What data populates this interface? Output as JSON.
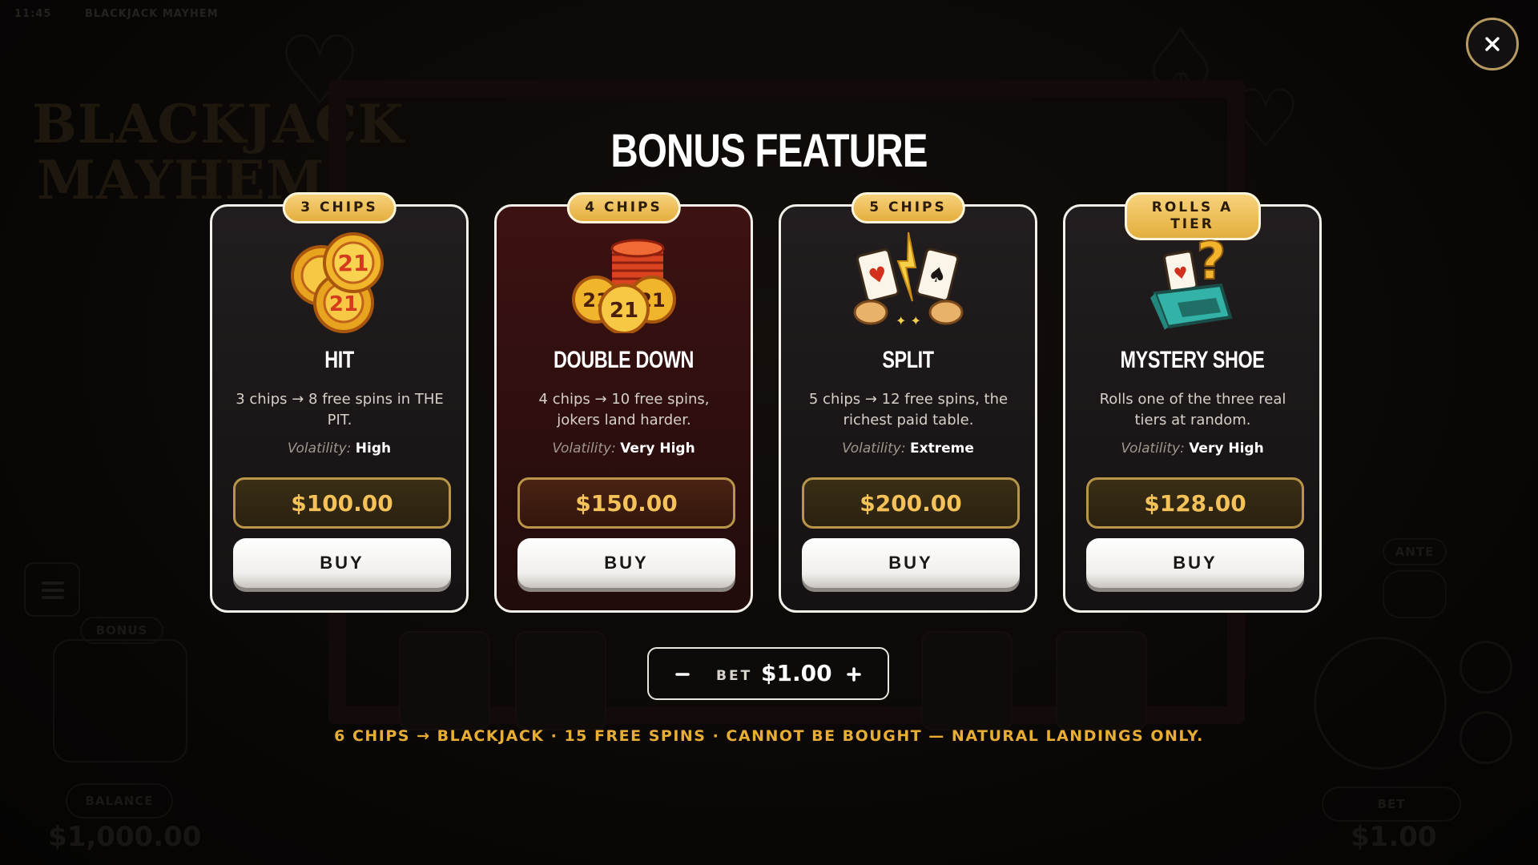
{
  "background": {
    "top_left": [
      "11:45",
      "BLACKJACK MAYHEM"
    ],
    "logo_line1": "BLACKJACK",
    "logo_line2": "MAYHEM",
    "bonus_label": "BONUS",
    "balance_label": "BALANCE",
    "balance_value": "$1,000.00",
    "ante_label": "ANTE",
    "bet_label": "BET",
    "bet_value": "$1.00"
  },
  "modal": {
    "title": "BONUS FEATURE",
    "cards": [
      {
        "badge": "3 CHIPS",
        "title": "HIT",
        "description": "3 chips → 8 free spins in THE PIT.",
        "volatility_label": "Volatility:",
        "volatility_value": "High",
        "price": "$100.00",
        "buy_label": "BUY",
        "icon": "gold-chips-icon"
      },
      {
        "badge": "4 CHIPS",
        "title": "DOUBLE DOWN",
        "description": "4 chips → 10 free spins, jokers land harder.",
        "volatility_label": "Volatility:",
        "volatility_value": "Very High",
        "price": "$150.00",
        "buy_label": "BUY",
        "icon": "chip-stack-icon"
      },
      {
        "badge": "5 CHIPS",
        "title": "SPLIT",
        "description": "5 chips → 12 free spins, the richest paid table.",
        "volatility_label": "Volatility:",
        "volatility_value": "Extreme",
        "price": "$200.00",
        "buy_label": "BUY",
        "icon": "split-cards-icon"
      },
      {
        "badge": "ROLLS A TIER",
        "title": "MYSTERY SHOE",
        "description": "Rolls one of the three real tiers at random.",
        "volatility_label": "Volatility:",
        "volatility_value": "Very High",
        "price": "$128.00",
        "buy_label": "BUY",
        "icon": "mystery-shoe-icon"
      }
    ],
    "bet": {
      "label": "BET",
      "value": "$1.00",
      "minus": "−",
      "plus": "+"
    },
    "footnote": "6 CHIPS → BLACKJACK · 15 FREE SPINS · CANNOT BE BOUGHT — NATURAL LANDINGS ONLY."
  },
  "colors": {
    "accent_gold": "#e8ad33",
    "price_text": "#f4c259",
    "featured_card_bg": "#3d1212",
    "card_bg": "#1c1819"
  }
}
